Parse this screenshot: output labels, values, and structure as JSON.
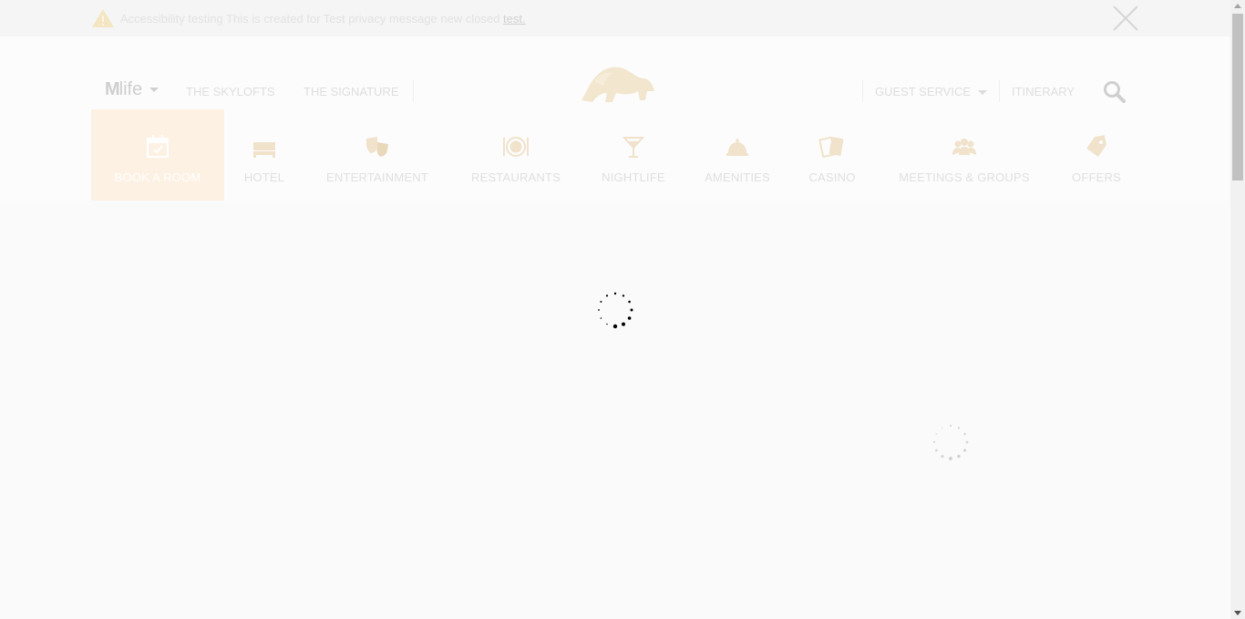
{
  "alert": {
    "message": "Accessibility testing This is created for Test privacy message new closed ",
    "link_text": "test.",
    "icon": "warning-icon",
    "close_icon": "close-icon"
  },
  "header": {
    "brand_bold": "M",
    "brand_rest": "life",
    "links_left": [
      "THE SKYLOFTS",
      "THE SIGNATURE"
    ],
    "logo": "lion-logo",
    "guest_service": "GUEST SERVICE",
    "itinerary": "ITINERARY",
    "search_icon": "search-icon"
  },
  "nav": {
    "items": [
      {
        "label": "BOOK A ROOM",
        "icon": "calendar-icon",
        "active": true
      },
      {
        "label": "HOTEL",
        "icon": "bed-icon"
      },
      {
        "label": "ENTERTAINMENT",
        "icon": "masks-icon"
      },
      {
        "label": "RESTAURANTS",
        "icon": "plate-icon"
      },
      {
        "label": "NIGHTLIFE",
        "icon": "cocktail-icon"
      },
      {
        "label": "AMENITIES",
        "icon": "cloche-icon"
      },
      {
        "label": "CASINO",
        "icon": "cards-icon"
      },
      {
        "label": "MEETINGS & GROUPS",
        "icon": "group-icon"
      },
      {
        "label": "OFFERS",
        "icon": "tag-icon"
      }
    ]
  },
  "colors": {
    "active_tab": "#fdf1e3",
    "logo_gold": "#f3e6cf",
    "page_bg": "#fafafa"
  }
}
